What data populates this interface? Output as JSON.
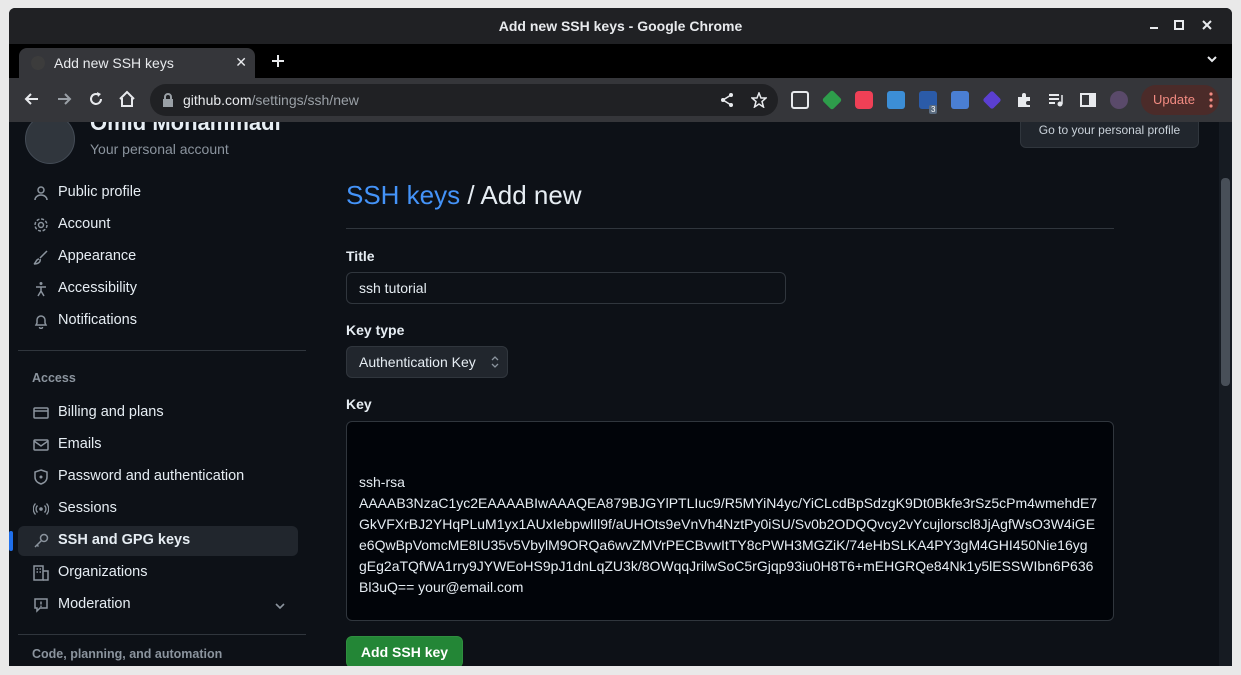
{
  "window": {
    "title": "Add new SSH keys - Google Chrome"
  },
  "tabs": [
    {
      "label": "Add new SSH keys",
      "close": "✕"
    }
  ],
  "address_bar": {
    "host": "github.com",
    "path": "/settings/ssh/new"
  },
  "toolbar": {
    "update_label": "Update",
    "badge_count": "3"
  },
  "profile": {
    "name": "Omid Mohammadi",
    "subtitle": "Your personal account",
    "profile_button": "Go to your personal profile"
  },
  "sidebar": {
    "items_top": [
      {
        "label": "Public profile",
        "icon": "person-icon"
      },
      {
        "label": "Account",
        "icon": "gear-icon"
      },
      {
        "label": "Appearance",
        "icon": "paintbrush-icon"
      },
      {
        "label": "Accessibility",
        "icon": "accessibility-icon"
      },
      {
        "label": "Notifications",
        "icon": "bell-icon"
      }
    ],
    "section_access": "Access",
    "items_access": [
      {
        "label": "Billing and plans",
        "icon": "credit-card-icon"
      },
      {
        "label": "Emails",
        "icon": "mail-icon"
      },
      {
        "label": "Password and authentication",
        "icon": "shield-icon"
      },
      {
        "label": "Sessions",
        "icon": "broadcast-icon"
      },
      {
        "label": "SSH and GPG keys",
        "icon": "key-icon",
        "active": true
      },
      {
        "label": "Organizations",
        "icon": "organization-icon"
      },
      {
        "label": "Moderation",
        "icon": "report-icon"
      }
    ],
    "section_code": "Code, planning, and automation"
  },
  "main": {
    "breadcrumb": "SSH keys",
    "heading_sep": " / ",
    "heading": "Add new",
    "title_label": "Title",
    "title_value": "ssh tutorial",
    "keytype_label": "Key type",
    "keytype_value": "Authentication Key",
    "key_label": "Key",
    "key_lines": [
      "ssh-rsa",
      "AAAAB3NzaC1yc2EAAAABIwAAAQEA879BJGYlPTLIuc9/R5MYiN4yc/YiCLcdBpSdzgK9Dt0Bkfe3rSz5cPm4wmehdE7",
      "GkVFXrBJ2YHqPLuM1yx1AUxIebpwlIl9f/aUHOts9eVnVh4NztPy0iSU/Sv0b2ODQQvcy2vYcujlorscl8JjAgfWsO3W4iGE",
      "e6QwBpVomcME8IU35v5VbylM9ORQa6wvZMVrPECBvwItTY8cPWH3MGZiK/74eHbSLKA4PY3gM4GHI450Nie16yg",
      "gEg2aTQfWA1rry9JYWEoHS9pJ1dnLqZU3k/8OWqqJrilwSoC5rGjqp93iu0H8T6+mEHGRQe84Nk1y5lESSWIbn6P636",
      "Bl3uQ== your@email.com"
    ],
    "submit_label": "Add SSH key"
  }
}
